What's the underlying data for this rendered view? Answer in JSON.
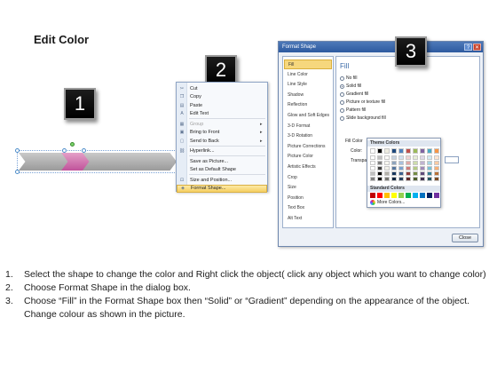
{
  "title": "Edit Color",
  "badges": [
    "1",
    "2",
    "3"
  ],
  "context_menu": {
    "items": [
      {
        "label": "Cut",
        "icon": "scissors-icon",
        "glyph": "✂",
        "disabled": false,
        "arrow": false
      },
      {
        "label": "Copy",
        "icon": "copy-icon",
        "glyph": "❐",
        "disabled": false,
        "arrow": false
      },
      {
        "label": "Paste",
        "icon": "paste-icon",
        "glyph": "▤",
        "disabled": false,
        "arrow": false
      },
      {
        "label": "Edit Text",
        "icon": "edit-text-icon",
        "glyph": "A",
        "disabled": false,
        "arrow": false
      },
      {
        "label": "Group",
        "icon": "group-icon",
        "glyph": "▦",
        "disabled": true,
        "arrow": true
      },
      {
        "label": "Bring to Front",
        "icon": "bring-front-icon",
        "glyph": "▣",
        "disabled": false,
        "arrow": true
      },
      {
        "label": "Send to Back",
        "icon": "send-back-icon",
        "glyph": "▢",
        "disabled": false,
        "arrow": true
      },
      {
        "label": "Hyperlink...",
        "icon": "hyperlink-icon",
        "glyph": "⛓",
        "disabled": false,
        "arrow": false
      },
      {
        "label": "Save as Picture...",
        "icon": "",
        "glyph": "",
        "disabled": false,
        "arrow": false
      },
      {
        "label": "Set as Default Shape",
        "icon": "",
        "glyph": "",
        "disabled": false,
        "arrow": false
      },
      {
        "label": "Size and Position...",
        "icon": "size-position-icon",
        "glyph": "⊡",
        "disabled": false,
        "arrow": false
      },
      {
        "label": "Format Shape...",
        "icon": "format-shape-icon",
        "glyph": "◈",
        "disabled": false,
        "arrow": false,
        "highlight": true
      }
    ]
  },
  "dialog": {
    "title": "Format Shape",
    "help": "?",
    "close_glyph": "✕",
    "nav": [
      "Fill",
      "Line Color",
      "Line Style",
      "Shadow",
      "Reflection",
      "Glow and Soft Edges",
      "3-D Format",
      "3-D Rotation",
      "Picture Corrections",
      "Picture Color",
      "Artistic Effects",
      "Crop",
      "Size",
      "Position",
      "Text Box",
      "Alt Text"
    ],
    "pane_title": "Fill",
    "fill_options": [
      {
        "label": "No fill",
        "selected": false
      },
      {
        "label": "Solid fill",
        "selected": true
      },
      {
        "label": "Gradient fill",
        "selected": false
      },
      {
        "label": "Picture or texture fill",
        "selected": false
      },
      {
        "label": "Pattern fill",
        "selected": false
      },
      {
        "label": "Slide background fill",
        "selected": false
      }
    ],
    "fill_color_label": "Fill Color",
    "color_label": "Color:",
    "transparency_label": "Transparency:",
    "close_button": "Close"
  },
  "palette": {
    "theme_title": "Theme Colors",
    "standard_title": "Standard Colors",
    "more_colors": "More Colors...",
    "theme_columns": [
      "#ffffff",
      "#000000",
      "#eeece1",
      "#1f497d",
      "#4f81bd",
      "#c0504d",
      "#9bbb59",
      "#8064a2",
      "#4bacc6",
      "#f79646"
    ],
    "standard": [
      "#c00000",
      "#ff0000",
      "#ffc000",
      "#ffff00",
      "#92d050",
      "#00b050",
      "#00b0f0",
      "#0070c0",
      "#002060",
      "#7030a0"
    ]
  },
  "colors": {
    "chevron": "#a8a8a8",
    "chevron_selected": "#d46aae",
    "dialog_title": "#2d5aa0",
    "highlight": "#f6cf62"
  },
  "instructions": [
    {
      "num": "1.",
      "text": "Select the shape to change the color and Right click the object( click any object which you want to change color)"
    },
    {
      "num": "2.",
      "text": "Choose Format Shape in the dialog box."
    },
    {
      "num": "3.",
      "text": "Choose “Fill” in the Format Shape box then “Solid” or “Gradient” depending on the appearance of the object. Change colour as shown in the picture."
    }
  ]
}
